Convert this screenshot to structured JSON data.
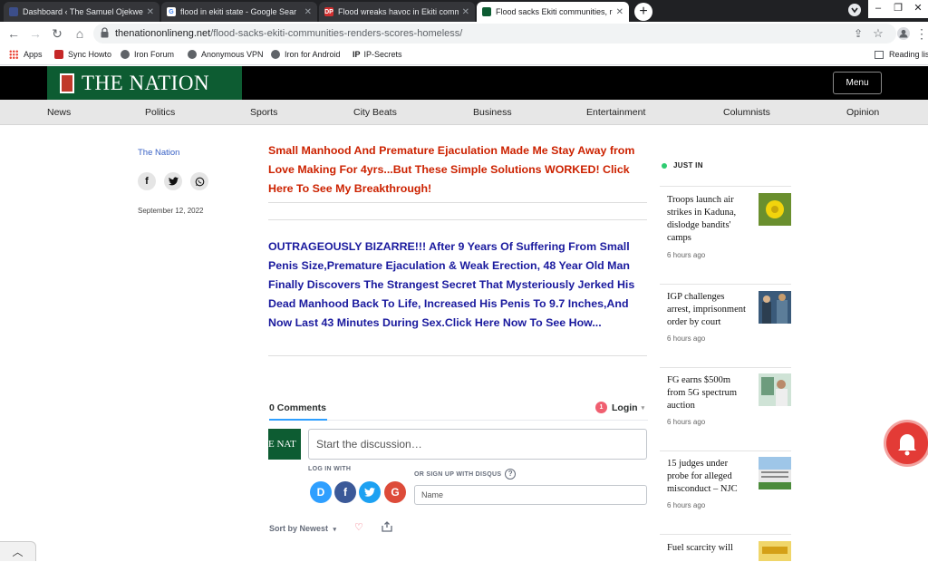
{
  "browser": {
    "tabs": [
      {
        "title": "Dashboard ‹ The Samuel Ojekwe",
        "active": false
      },
      {
        "title": "flood in ekiti state - Google Sear",
        "active": false
      },
      {
        "title": "Flood wreaks havoc in Ekiti comm",
        "active": false
      },
      {
        "title": "Flood sacks Ekiti communities, re",
        "active": true
      }
    ],
    "url_host": "thenationonlineng.net",
    "url_path": "/flood-sacks-ekiti-communities-renders-scores-homeless/",
    "bookmarks": [
      "Apps",
      "Sync Howto",
      "Iron Forum",
      "Anonymous VPN",
      "Iron for Android",
      "IP-Secrets"
    ],
    "reading_list": "Reading list"
  },
  "site": {
    "logo_text": "THE NATION",
    "menu_label": "Menu",
    "nav": [
      "News",
      "Politics",
      "Sports",
      "City Beats",
      "Business",
      "Entertainment",
      "Columnists",
      "Opinion"
    ]
  },
  "article": {
    "author": "The Nation",
    "date": "September 12, 2022",
    "ad1": "Small Manhood And Premature Ejaculation Made Me Stay Away from Love Making For 4yrs...But These Simple Solutions WORKED! Click Here To See My Breakthrough!",
    "ad2": "OUTRAGEOUSLY BIZARRE!!! After 9 Years Of Suffering From Small Penis Size,Premature Ejaculation & Weak Erection, 48 Year Old Man Finally Discovers The Strangest Secret That Mysteriously Jerked His Dead Manhood Back To Life, Increased His Penis To 9.7 Inches,And Now Last 43 Minutes During Sex.Click Here Now To See How..."
  },
  "disqus": {
    "comments_count": "0 Comments",
    "login_label": "Login",
    "notification_count": "1",
    "avatar_text": "E NAT",
    "input_placeholder": "Start the discussion…",
    "log_in_with": "LOG IN WITH",
    "or_signup": "OR SIGN UP WITH DISQUS",
    "name_placeholder": "Name",
    "sort_label": "Sort by Newest"
  },
  "just_in": {
    "label": "JUST IN",
    "stories": [
      {
        "headline": "Troops launch air strikes in Kaduna, dislodge bandits' camps",
        "time": "6 hours ago"
      },
      {
        "headline": "IGP challenges arrest, imprisonment order by court",
        "time": "6 hours ago"
      },
      {
        "headline": "FG earns $500m from 5G spectrum auction",
        "time": "6 hours ago"
      },
      {
        "headline": "15 judges under probe for alleged misconduct – NJC",
        "time": "6 hours ago"
      },
      {
        "headline": "Fuel scarcity will",
        "time": ""
      }
    ]
  },
  "colors": {
    "ad_red": "#cc2200",
    "ad_blue": "#1a1a9e",
    "brand_green": "#0d5c32",
    "link_blue": "#3b63c6",
    "disqus_blue": "#2e9fff"
  }
}
